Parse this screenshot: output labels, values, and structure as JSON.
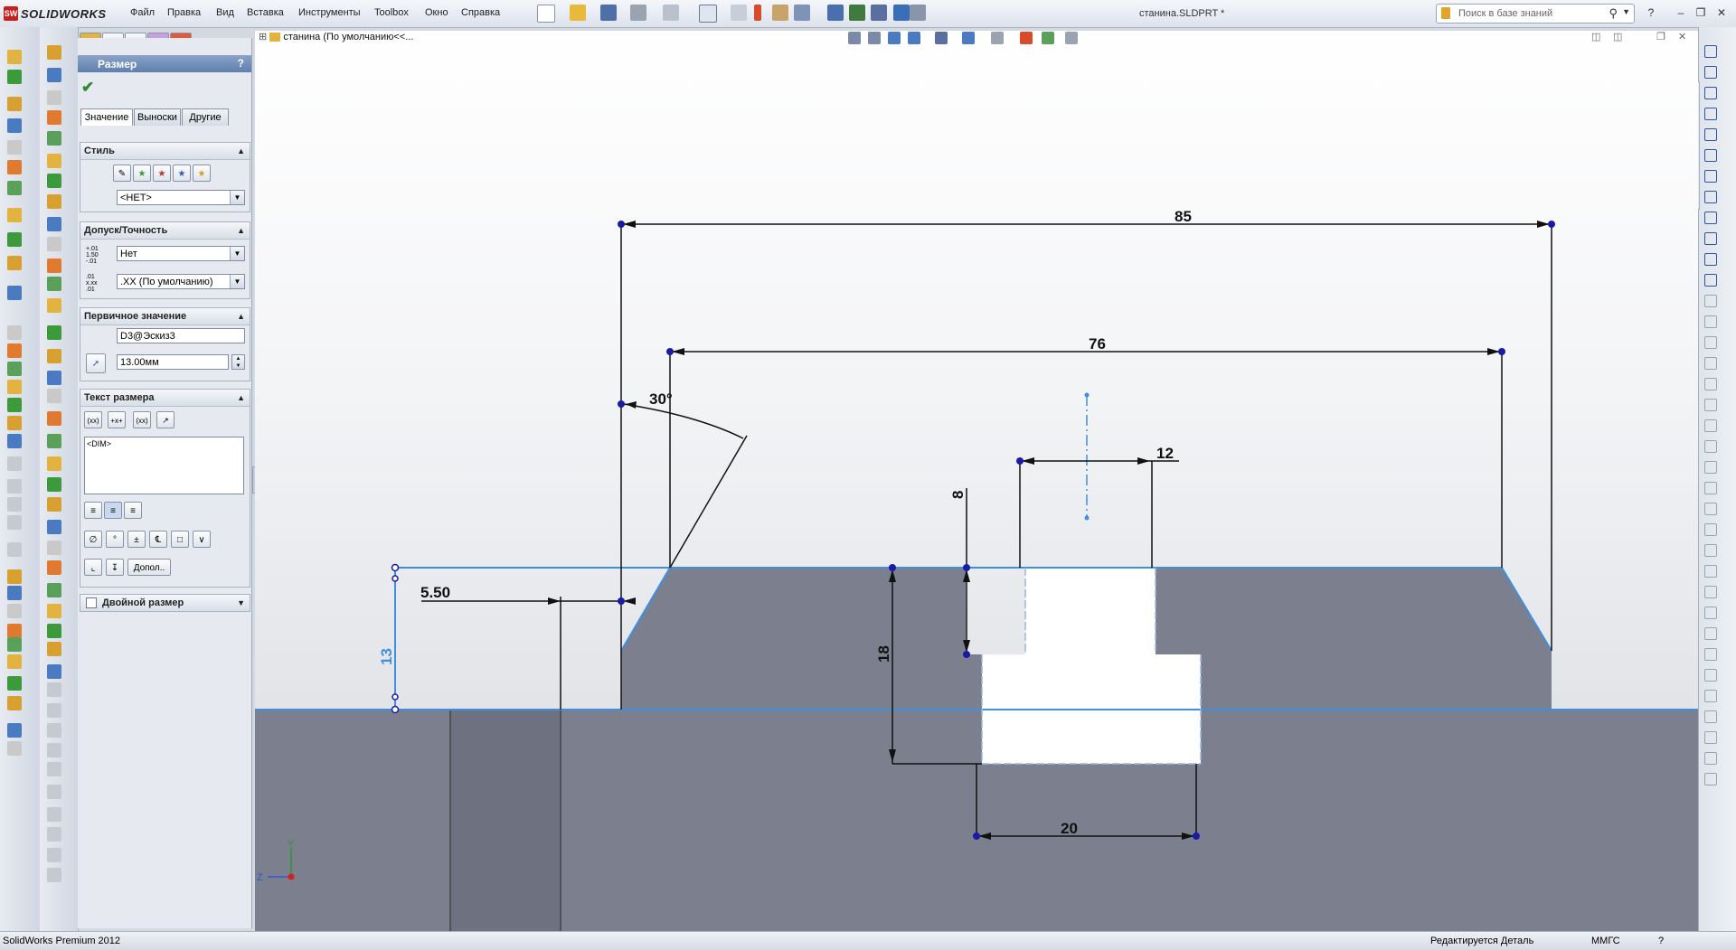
{
  "app": {
    "brand": "SOLIDWORKS",
    "logo_badge": "SW"
  },
  "menu": [
    "Файл",
    "Правка",
    "Вид",
    "Вставка",
    "Инструменты",
    "Toolbox",
    "Окно",
    "Справка"
  ],
  "document_title": "станина.SLDPRT *",
  "search": {
    "placeholder": "Поиск в базе знаний"
  },
  "feature_tree": {
    "label": "станина  (По умолчанию<<..."
  },
  "property_manager": {
    "title": "Размер",
    "help": "?",
    "tabs": [
      "Значение",
      "Выноски",
      "Другие"
    ],
    "style": {
      "header": "Стиль",
      "select_value": "<НЕТ>"
    },
    "tolerance": {
      "header": "Допуск/Точность",
      "tol_type": "Нет",
      "precision": ".XX (По умолчанию)"
    },
    "primary_value": {
      "header": "Первичное значение",
      "name": "D3@Эскиз3",
      "value": "13.00мм"
    },
    "dim_text": {
      "header": "Текст размера",
      "text": "<DIM>",
      "more_button": "Допол.."
    },
    "dual_dim": {
      "header": "Двойной размер"
    }
  },
  "dimensions": {
    "d85": "85",
    "d76": "76",
    "d30": "30°",
    "d12": "12",
    "d8": "8",
    "d5_50": "5.50",
    "d13": "13",
    "d18": "18",
    "d20": "20"
  },
  "triad": {
    "y": "Y",
    "z": "Z"
  },
  "status": {
    "product": "SolidWorks Premium 2012",
    "mode": "Редактируется Деталь",
    "units": "ММГС",
    "help": "?"
  },
  "colors": {
    "model_gray": "#7b7f8e",
    "sketch_blue": "#3f8fe0",
    "point": "#1a1aa8"
  }
}
